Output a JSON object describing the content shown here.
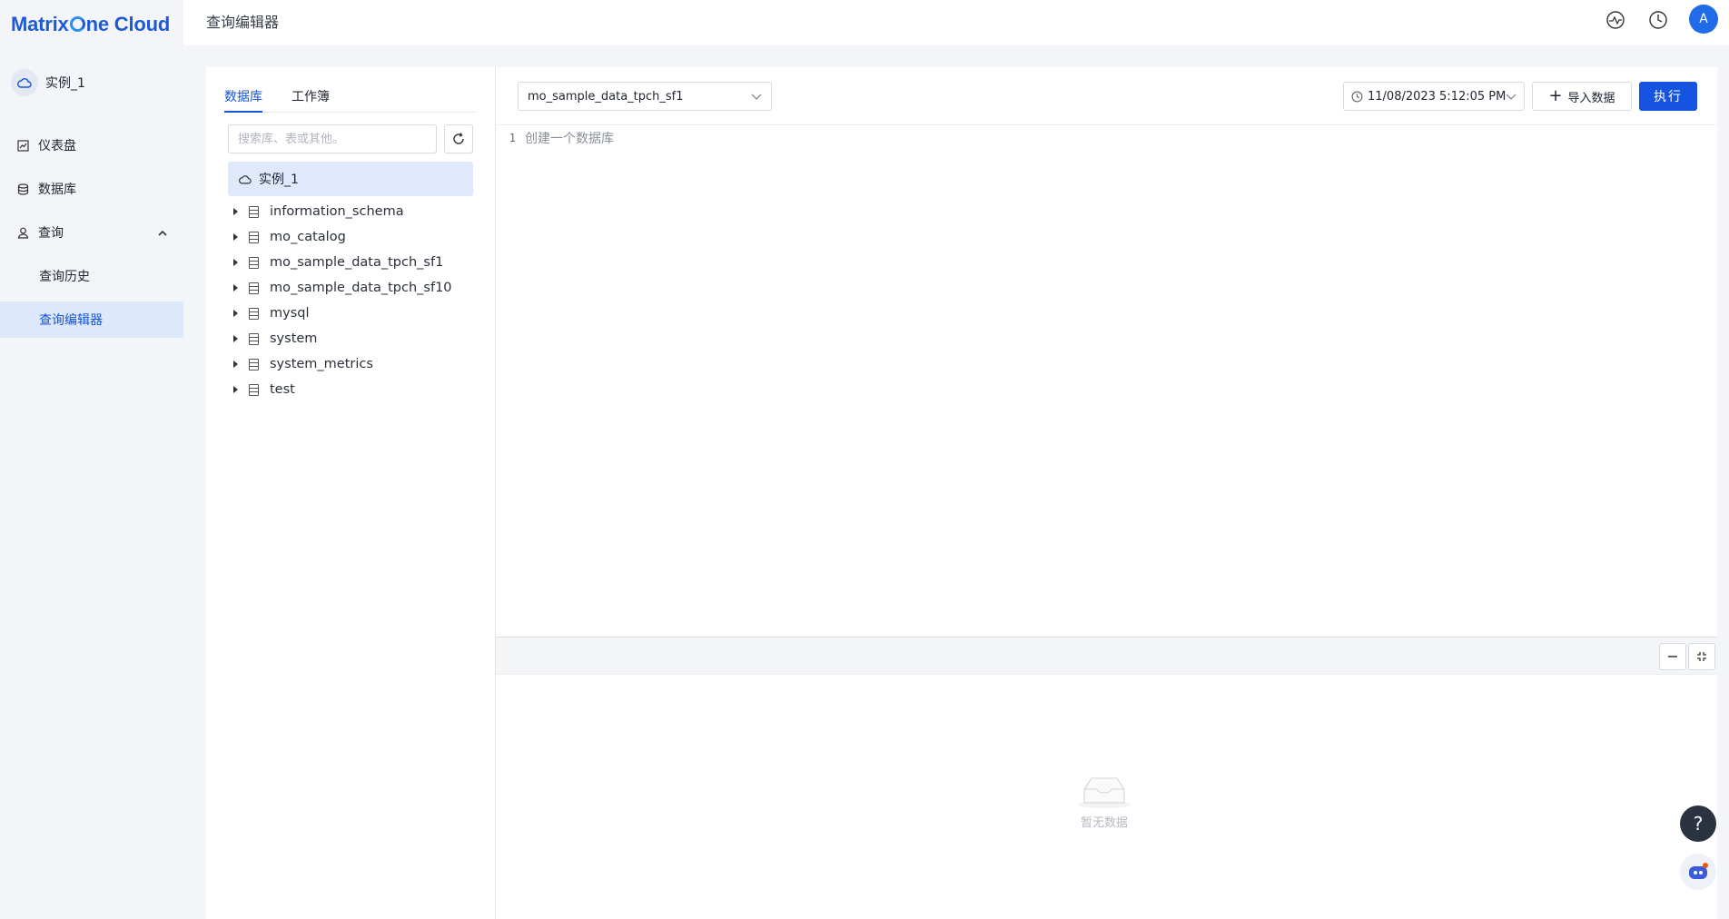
{
  "app": {
    "logo_text_1": "Matrix",
    "logo_text_2": "ne Cloud"
  },
  "sidebar": {
    "instance_label": "实例_1",
    "items": [
      {
        "label": "仪表盘",
        "icon": "dashboard-icon"
      },
      {
        "label": "数据库",
        "icon": "database-icon"
      },
      {
        "label": "查询",
        "icon": "user-icon",
        "expanded": true
      }
    ],
    "sub_items": [
      {
        "label": "查询历史",
        "active": false
      },
      {
        "label": "查询编辑器",
        "active": true
      }
    ]
  },
  "header": {
    "title": "查询编辑器",
    "avatar_letter": "A"
  },
  "leftpanel": {
    "tabs": [
      {
        "label": "数据库",
        "active": true
      },
      {
        "label": "工作簿",
        "active": false
      }
    ],
    "search_placeholder": "搜索库、表或其他。",
    "root_label": "实例_1",
    "databases": [
      "information_schema",
      "mo_catalog",
      "mo_sample_data_tpch_sf1",
      "mo_sample_data_tpch_sf10",
      "mysql",
      "system",
      "system_metrics",
      "test"
    ]
  },
  "editor": {
    "selected_db": "mo_sample_data_tpch_sf1",
    "timestamp": "11/08/2023 5:12:05 PM",
    "import_label": "导入数据",
    "run_label": "执行",
    "lines": [
      {
        "num": "1",
        "text": "创建一个数据库"
      }
    ]
  },
  "results": {
    "empty_text": "暂无数据"
  },
  "floating": {
    "help_label": "?"
  },
  "colors": {
    "accent": "#1553e0",
    "active_bg": "#dde8fa",
    "sidebar_bg": "#f3f5f9"
  }
}
